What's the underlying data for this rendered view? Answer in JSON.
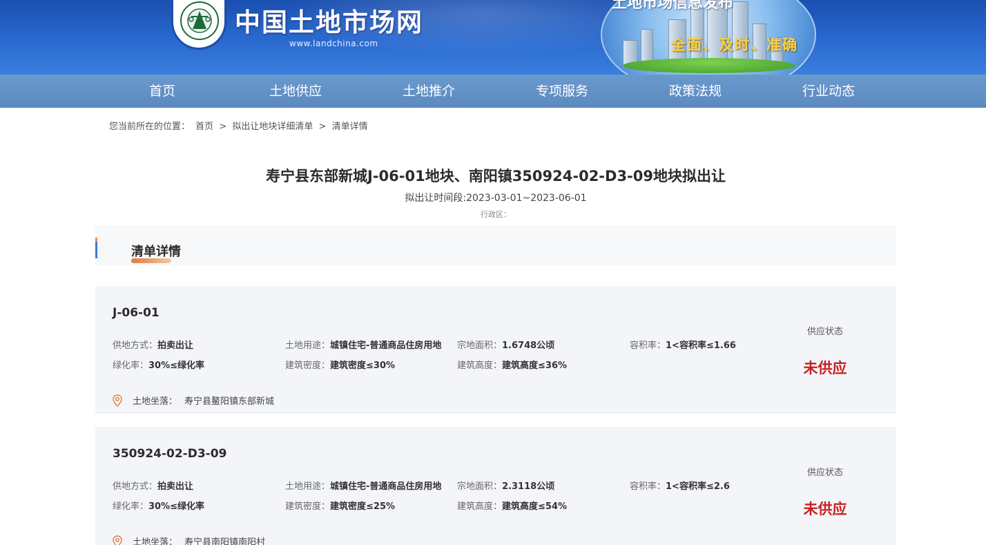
{
  "header": {
    "site_title": "中国土地市场网",
    "site_url": "www.landchina.com",
    "slogan": "全面、及时、准确",
    "banner_text": "土地市场信息发布"
  },
  "nav": {
    "items": [
      "首页",
      "土地供应",
      "土地推介",
      "专项服务",
      "政策法规",
      "行业动态"
    ]
  },
  "breadcrumb": {
    "prefix": "您当前所在的位置：",
    "items": [
      "首页",
      "拟出让地块详细清单",
      "清单详情"
    ],
    "separator": ">"
  },
  "page": {
    "title": "寿宁县东部新城J-06-01地块、南阳镇350924-02-D3-09地块拟出让",
    "period": "拟出让时间段:2023-03-01~2023-06-01",
    "region": "行政区："
  },
  "section": {
    "title": "清单详情"
  },
  "labels": {
    "supply_method": "供地方式：",
    "land_use": "土地用途：",
    "area": "宗地面积：",
    "plot_ratio": "容积率：",
    "green_rate": "绿化率：",
    "building_density": "建筑密度：",
    "building_height": "建筑高度：",
    "location": "土地坐落：",
    "status": "供应状态"
  },
  "parcels": [
    {
      "code": "J-06-01",
      "supply_method": "拍卖出让",
      "land_use": "城镇住宅-普通商品住房用地",
      "area": "1.6748公顷",
      "plot_ratio": "1<容积率≤1.66",
      "green_rate": "30%≤绿化率",
      "building_density": "建筑密度≤30%",
      "building_height": "建筑高度≤36%",
      "location": "寿宁县鳌阳镇东部新城",
      "status": "未供应"
    },
    {
      "code": "350924-02-D3-09",
      "supply_method": "拍卖出让",
      "land_use": "城镇住宅-普通商品住房用地",
      "area": "2.3118公顷",
      "plot_ratio": "1<容积率≤2.6",
      "green_rate": "30%≤绿化率",
      "building_density": "建筑密度≤25%",
      "building_height": "建筑高度≤54%",
      "location": "寿宁县南阳镇南阳村",
      "status": "未供应"
    }
  ],
  "colors": {
    "banner_blue": "#2a6ad0",
    "nav_blue": "#5b8ac0",
    "status_red": "#c81e1e",
    "accent_orange": "#e07b3d"
  }
}
